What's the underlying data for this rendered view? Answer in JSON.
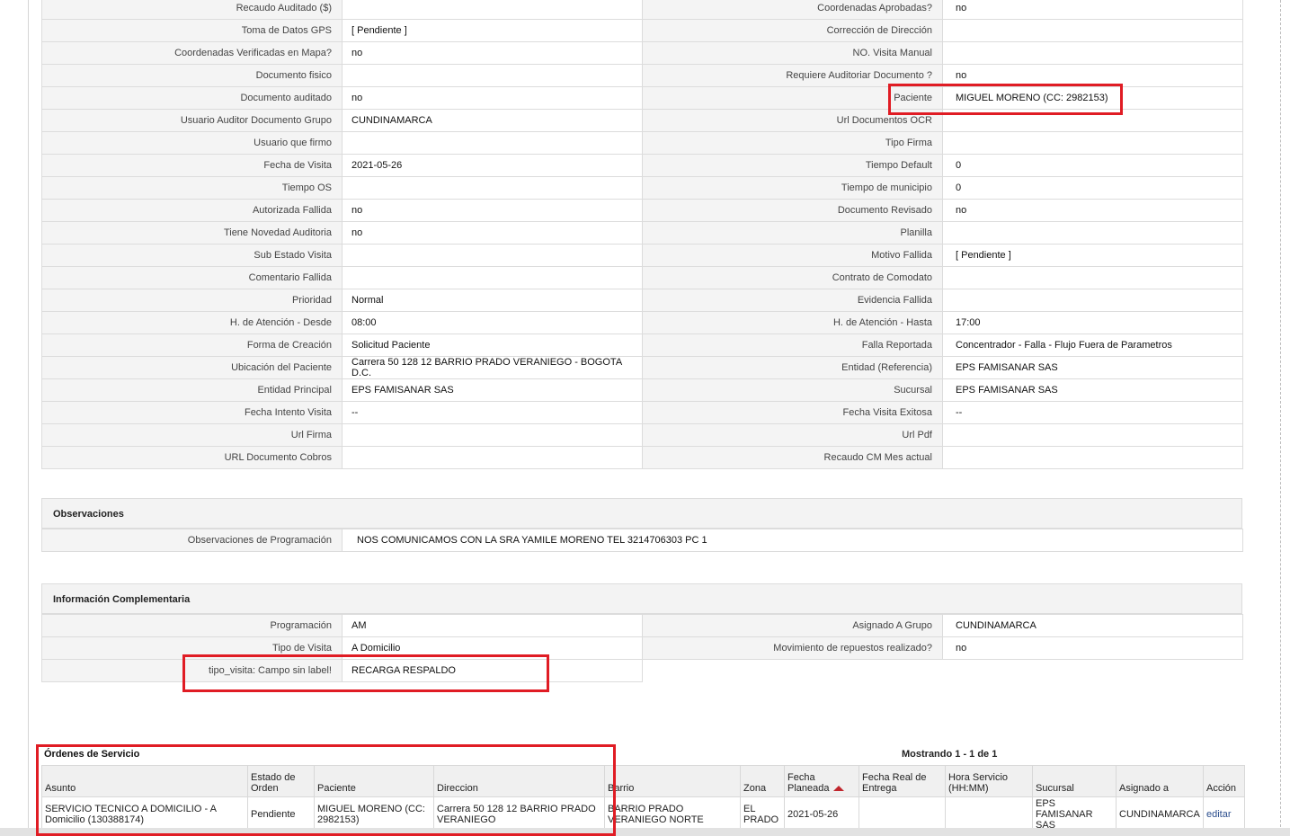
{
  "details": {
    "rows": [
      {
        "l1": "Recaudo Auditado ($)",
        "v1": "",
        "l2": "Coordenadas Aprobadas?",
        "v2": "no"
      },
      {
        "l1": "Toma de Datos GPS",
        "v1": "[ Pendiente ]",
        "l2": "Corrección de Dirección",
        "v2": ""
      },
      {
        "l1": "Coordenadas Verificadas en Mapa?",
        "v1": "no",
        "l2": "NO. Visita Manual",
        "v2": ""
      },
      {
        "l1": "Documento fisico",
        "v1": "",
        "l2": "Requiere Auditoriar Documento ?",
        "v2": "no"
      },
      {
        "l1": "Documento auditado",
        "v1": "no",
        "l2": "Paciente",
        "v2": "MIGUEL MORENO (CC: 2982153)"
      },
      {
        "l1": "Usuario Auditor Documento Grupo",
        "v1": "CUNDINAMARCA",
        "l2": "Url Documentos OCR",
        "v2": ""
      },
      {
        "l1": "Usuario que firmo",
        "v1": "",
        "l2": "Tipo Firma",
        "v2": ""
      },
      {
        "l1": "Fecha de Visita",
        "v1": "2021-05-26",
        "l2": "Tiempo Default",
        "v2": "0"
      },
      {
        "l1": "Tiempo OS",
        "v1": "",
        "l2": "Tiempo de municipio",
        "v2": "0"
      },
      {
        "l1": "Autorizada Fallida",
        "v1": "no",
        "l2": "Documento Revisado",
        "v2": "no"
      },
      {
        "l1": "Tiene Novedad Auditoria",
        "v1": "no",
        "l2": "Planilla",
        "v2": ""
      },
      {
        "l1": "Sub Estado Visita",
        "v1": "",
        "l2": "Motivo Fallida",
        "v2": "[ Pendiente ]"
      },
      {
        "l1": "Comentario Fallida",
        "v1": "",
        "l2": "Contrato de Comodato",
        "v2": ""
      },
      {
        "l1": "Prioridad",
        "v1": "Normal",
        "l2": "Evidencia Fallida",
        "v2": ""
      },
      {
        "l1": "H. de Atención - Desde",
        "v1": "08:00",
        "l2": "H. de Atención - Hasta",
        "v2": "17:00"
      },
      {
        "l1": "Forma de Creación",
        "v1": "Solicitud Paciente",
        "l2": "Falla Reportada",
        "v2": "Concentrador - Falla - Flujo Fuera de Parametros"
      },
      {
        "l1": "Ubicación del Paciente",
        "v1": "Carrera 50 128 12 BARRIO PRADO VERANIEGO - BOGOTA D.C.",
        "l2": "Entidad (Referencia)",
        "v2": "EPS FAMISANAR SAS"
      },
      {
        "l1": "Entidad Principal",
        "v1": "EPS FAMISANAR SAS",
        "l2": "Sucursal",
        "v2": "EPS FAMISANAR SAS"
      },
      {
        "l1": "Fecha Intento Visita",
        "v1": "--",
        "l2": "Fecha Visita Exitosa",
        "v2": "--"
      },
      {
        "l1": "Url Firma",
        "v1": "",
        "l2": "Url Pdf",
        "v2": ""
      },
      {
        "l1": "URL Documento Cobros",
        "v1": "",
        "l2": "Recaudo CM Mes actual",
        "v2": ""
      }
    ]
  },
  "observaciones": {
    "title": "Observaciones",
    "label": "Observaciones de Programación",
    "value": "NOS COMUNICAMOS CON LA SRA YAMILE MORENO TEL 3214706303 PC 1"
  },
  "info": {
    "title": "Información Complementaria",
    "rows": [
      {
        "l1": "Programación",
        "v1": "AM",
        "l2": "Asignado A Grupo",
        "v2": "CUNDINAMARCA"
      },
      {
        "l1": "Tipo de Visita",
        "v1": "A Domicilio",
        "l2": "Movimiento de repuestos realizado?",
        "v2": "no"
      }
    ],
    "extra": {
      "label": "tipo_visita: Campo sin label!",
      "value": "RECARGA RESPALDO"
    }
  },
  "orders": {
    "title": "Órdenes de Servicio",
    "showing": "Mostrando 1 - 1 de 1",
    "headers": {
      "asunto": "Asunto",
      "estado": "Estado de Orden",
      "paciente": "Paciente",
      "direccion": "Direccion",
      "barrio": "Barrio",
      "zona": "Zona",
      "fecha_planeada": "Fecha Planeada",
      "fecha_real": "Fecha Real de Entrega",
      "hora": "Hora Servicio (HH:MM)",
      "sucursal": "Sucursal",
      "asignado": "Asignado a",
      "accion": "Acción"
    },
    "row": {
      "asunto": "SERVICIO TECNICO A DOMICILIO - A Domicilio (130388174)",
      "estado": "Pendiente",
      "paciente": "MIGUEL MORENO (CC: 2982153)",
      "direccion": "Carrera 50 128 12 BARRIO PRADO VERANIEGO",
      "barrio": "BARRIO PRADO VERANIEGO NORTE",
      "zona": "EL PRADO",
      "fecha_planeada": "2021-05-26",
      "fecha_real": "",
      "hora": "",
      "sucursal": "EPS FAMISANAR SAS",
      "asignado": "CUNDINAMARCA",
      "accion": "editar"
    }
  },
  "colors": {
    "highlight": "#e01c24",
    "label_bg": "#f4f4f4",
    "border": "#dcdcdc",
    "sort_arrow": "#c0262d"
  }
}
